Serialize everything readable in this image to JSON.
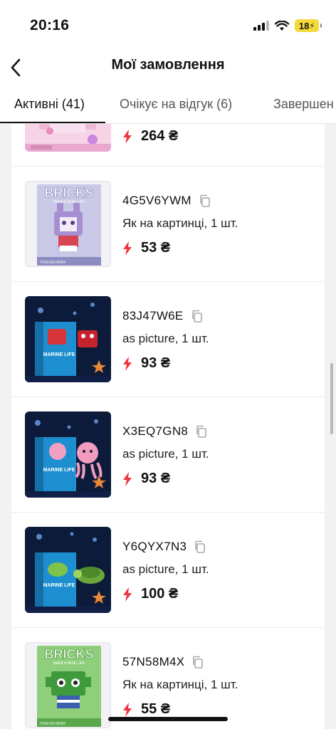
{
  "status_bar": {
    "time": "20:16",
    "battery": "18"
  },
  "nav": {
    "title": "Мої замовлення"
  },
  "tabs": [
    {
      "label": "Активні (41)"
    },
    {
      "label": "Очікує на відгук (6)"
    },
    {
      "label": "Завершен"
    }
  ],
  "orders": [
    {
      "id": "",
      "variant": "",
      "price": "264 ₴",
      "thumb": "pink-castle"
    },
    {
      "id": "4G5V6YWM",
      "variant": "Як на картинці, 1 шт.",
      "price": "53 ₴",
      "thumb": "bricks-bunny",
      "thumb_title": "BRICKS",
      "thumb_sub": "MAKE A WISE LIFE",
      "thumb_item": "ITEM NO.05004"
    },
    {
      "id": "83J47W6E",
      "variant": "as picture, 1 шт.",
      "price": "93 ₴",
      "thumb": "marine-crab",
      "thumb_title": "MARINE LIFE"
    },
    {
      "id": "X3EQ7GN8",
      "variant": "as picture, 1 шт.",
      "price": "93 ₴",
      "thumb": "marine-octopus",
      "thumb_title": "MARINE LIFE"
    },
    {
      "id": "Y6QYX7N3",
      "variant": "as picture, 1 шт.",
      "price": "100 ₴",
      "thumb": "marine-turtle",
      "thumb_title": "MARINE LIFE"
    },
    {
      "id": "57N58M4X",
      "variant": "Як на картинці, 1 шт.",
      "price": "55 ₴",
      "thumb": "bricks-alien",
      "thumb_title": "BRICKS",
      "thumb_sub": "MAKE A WISE LIFE",
      "thumb_item": "ITEM NO.05002"
    }
  ],
  "colors": {
    "accent_bolt": "#f0353f",
    "tab_active": "#111111"
  }
}
